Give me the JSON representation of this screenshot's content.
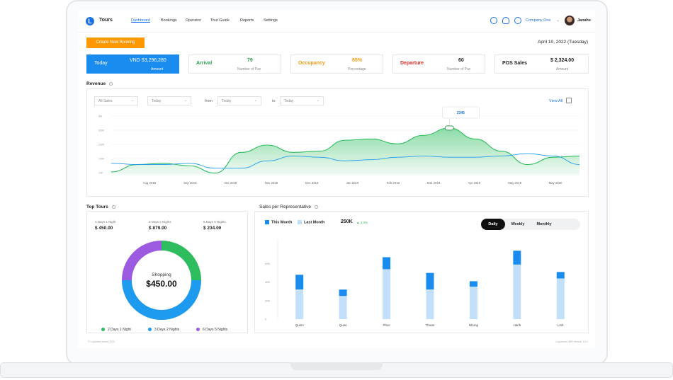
{
  "app": {
    "brand": "Tours",
    "logo_letter": "L"
  },
  "nav": [
    "Dashboard",
    "Bookings",
    "Operator",
    "Tour Guide",
    "Reports",
    "Settings"
  ],
  "topbar": {
    "company": "Company One",
    "user": "Janahs"
  },
  "actions": {
    "create_booking": "Create New Booking",
    "date": "April 10, 2022 (Tuesday)"
  },
  "kpis": {
    "today": {
      "label": "Today",
      "value": "VND 53,296,280",
      "sub": "Amount"
    },
    "arrival": {
      "label": "Arrival",
      "value": "79",
      "sub": "Number of Pax",
      "color": "#2e9e4f"
    },
    "occupancy": {
      "label": "Occupancy",
      "value": "85%",
      "sub": "Percentage",
      "color": "#f59a12"
    },
    "departure": {
      "label": "Departure",
      "value": "60",
      "sub": "Number of Pax",
      "color": "#e02d2d"
    },
    "pos": {
      "label": "POS Sales",
      "value": "$ 2,324.00",
      "sub": "Amount"
    }
  },
  "revenue": {
    "title": "Revenue",
    "filters": {
      "sales": "All Sales",
      "period": "Today",
      "from_label": "from",
      "from_value": "Today",
      "to_label": "to",
      "to_value": "Today"
    },
    "view_all": "View All",
    "tooltip": "2345"
  },
  "top_tours": {
    "title": "Top Tours",
    "tours": [
      {
        "name": "2 Days 1 Night",
        "price": "$ 450.00"
      },
      {
        "name": "3 Days 2 Nights",
        "price": "$ 879.00"
      },
      {
        "name": "6 Days 5 Nights",
        "price": "$ 234.00"
      }
    ],
    "center_label": "Shopping",
    "center_value": "$450.00",
    "legend": [
      "2 Days 1 Night",
      "3 Days 2 Nights",
      "6 Days 5 Nights"
    ]
  },
  "sales_rep": {
    "title": "Sales per Representative",
    "legend_this": "This Month",
    "legend_last": "Last Month",
    "total": "250K",
    "change": "▲ 4.3%",
    "tabs": [
      "Daily",
      "Weekly",
      "Monthly"
    ]
  },
  "footer": {
    "left": "© Logoband brand 2022",
    "right": "Logoband 1899 Version 1.0.0"
  },
  "chart_data": [
    {
      "type": "area",
      "title": "Revenue",
      "x": [
        "Aug 2018",
        "Sep 2018",
        "Oct 2018",
        "Nov 2018",
        "Dec 2018",
        "Jan 2019",
        "Feb 2019",
        "Mar 2019",
        "Apr 2019",
        "May 2019",
        "May 2020"
      ],
      "y_ticks": [
        "5M",
        "300K",
        "200K",
        "100K",
        "10K"
      ],
      "ylim": [
        0,
        5
      ],
      "series": [
        {
          "values": [
            0.3,
            0.9,
            1.0,
            0.8,
            0.2,
            1.9,
            2.5,
            1.9,
            2.0,
            2.9,
            3.0,
            2.6,
            3.3,
            3.9,
            3.0,
            2.0,
            0.9,
            1.5,
            1.6
          ]
        },
        {
          "values": [
            1.0,
            0.9,
            0.9,
            1.0,
            0.6,
            0.6,
            1.2,
            1.6,
            1.5,
            1.2,
            1.3,
            1.5,
            1.6,
            1.5,
            1.5,
            1.6,
            1.8,
            1.6,
            0.9
          ]
        }
      ],
      "tooltip_value": "2345",
      "grid": true
    },
    {
      "type": "pie",
      "center_label": "Shopping",
      "center_value": "$450.00",
      "categories": [
        "2 Days 1 Night",
        "3 Days 2 Nights",
        "6 Days 5 Nights"
      ],
      "values": [
        25,
        50,
        25
      ],
      "colors": [
        "#2ebd5e",
        "#1e9bef",
        "#9c5ae0"
      ]
    },
    {
      "type": "bar",
      "categories": [
        "Quinn",
        "Quan",
        "Phuc",
        "Thuan",
        "Nhung",
        "Hanh",
        "Linh"
      ],
      "y_ticks": [
        "60K",
        "40K",
        "20K",
        "0"
      ],
      "ylim": [
        0,
        75
      ],
      "series": [
        {
          "name": "Last Month",
          "values": [
            32,
            25,
            54,
            32,
            35,
            59,
            44
          ]
        },
        {
          "name": "This Month",
          "values": [
            48,
            32,
            67,
            50,
            41,
            74,
            51
          ]
        }
      ],
      "colors": {
        "Last Month": "#c3e0fb",
        "This Month": "#1a8cf0"
      }
    }
  ]
}
